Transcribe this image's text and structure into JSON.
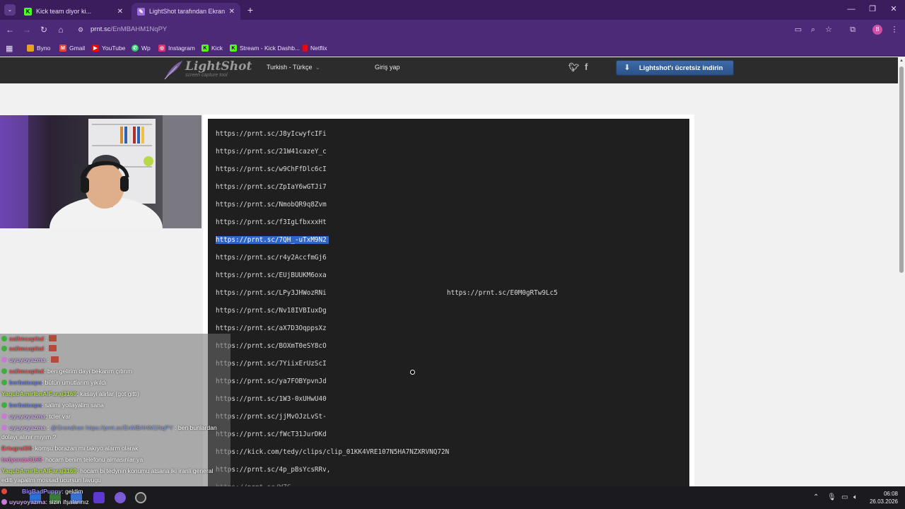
{
  "browser": {
    "tabs": [
      {
        "title": "Kick team diyor ki...",
        "favicon_color": "#53fc18"
      },
      {
        "title": "LightShot tarafından Ekran Gör",
        "favicon_color": "#9b6fd6"
      }
    ],
    "url_host": "prnt.sc",
    "url_path": "/EnMBAHM1NqPY",
    "bookmarks": [
      {
        "label": "Byno",
        "icon_color": "#e8a020"
      },
      {
        "label": "Gmail",
        "icon_color": "#ea4335"
      },
      {
        "label": "YouTube",
        "icon_color": "#ff0000"
      },
      {
        "label": "Wp",
        "icon_color": "#25d366"
      },
      {
        "label": "Instagram",
        "icon_color": "#e1306c"
      },
      {
        "label": "Kick",
        "icon_color": "#53fc18"
      },
      {
        "label": "Stream - Kick Dashb...",
        "icon_color": "#53fc18"
      },
      {
        "label": "Netflix",
        "icon_color": "#e50914"
      }
    ]
  },
  "lightshot": {
    "logo_name": "LightShot",
    "logo_tagline": "screen capture tool",
    "language": "Turkish - Türkçe",
    "login": "Giriş yap",
    "download_button": "Lightshot'ı ücretsiz indirin"
  },
  "screenshot_links": [
    "https://prnt.sc/J8yIcwyfcIFi",
    "https://prnt.sc/21W41cazeY_c",
    "https://prnt.sc/w9ChFfDlc6cI",
    "https://prnt.sc/ZpIaY6wGTJi7",
    "https://prnt.sc/NmobQR9q8Zvm",
    "https://prnt.sc/f3IgLfbxxxHt",
    "https://prnt.sc/7QH_-uTxM9N2",
    "https://prnt.sc/r4y2AccfmGj6",
    "https://prnt.sc/EUjBUUKM6oxa",
    "https://prnt.sc/LPy3JHWozRNi",
    "https://prnt.sc/Nv18IVBIuxDg",
    "https://prnt.sc/aX7D3OqppsXz",
    "https://prnt.sc/BOXmT0eSY8cO",
    "https://prnt.sc/7YiixErUzScI",
    "https://prnt.sc/ya7FOBYpvnJd",
    "https://prnt.sc/1W3-0xUHwU40",
    "https://prnt.sc/jjMvOJzLvSt-",
    "https://prnt.sc/fWcT31JurDKd",
    "https://kick.com/tedy/clips/clip_01KK4VRE107N5HA7NZXRVNQ72N",
    "https://prnt.sc/4p_pBsYcsRRv,"
  ],
  "screenshot_side_link": "https://prnt.sc/E0M0gRTw9Lc5",
  "chat": [
    {
      "user": "salimcapital",
      "text": "",
      "color": "red",
      "badge": "#3fae3f",
      "emote": true
    },
    {
      "user": "salimcapital",
      "text": "",
      "color": "red",
      "badge": "#3fae3f",
      "emote": true
    },
    {
      "user": "uyuyoyazma",
      "text": "",
      "color": "lav",
      "badge": "#c77ad6",
      "emote": true
    },
    {
      "user": "salimcapital",
      "text": ": ben gelirim dayı bekarım çıtırım",
      "color": "red",
      "badge": "#3fae3f"
    },
    {
      "user": "berbatcapa",
      "text": ": bütün umutlarım yıkıldı",
      "color": "blue",
      "badge": "#3fae3f"
    },
    {
      "user": "YaqubAmirIbnAlFaraj3169",
      "text": ": kasayi alirlar (got gitti)",
      "color": "yg",
      "badge": ""
    },
    {
      "user": "berbatcapa",
      "text": ": salimi yollayalim sana",
      "color": "blue",
      "badge": "#3fae3f"
    },
    {
      "user": "uyuyoyazma",
      "text": ": tcler var",
      "color": "lav",
      "badge": "#c77ad6"
    },
    {
      "user": "uyuyoyazma",
      "text": ": ben bunlardan",
      "color": "lav",
      "badge": "#c77ad6",
      "mention": "@Grendhan https://prnt.sc/EnMBAHM1NqPY"
    },
    {
      "user": "",
      "text": "dolayı alınır mıyım ?",
      "color": "",
      "badge": ""
    },
    {
      "user": "Ertugrul36",
      "text": ": komşu borazan mı takıyo alarm olarak",
      "color": "red",
      "badge": ""
    },
    {
      "user": "tedycrate3169",
      "text": ": hocam benim telefonu almasınlar ya",
      "color": "pink",
      "badge": ""
    },
    {
      "user": "YaqubAmirIbnAlFaraj3169",
      "text": ": hocam bi tedynin konumu atsana iki iranli general",
      "color": "yg",
      "badge": ""
    },
    {
      "user": "",
      "text": "editi yapalim mossad ucursun lavugu",
      "color": "",
      "badge": ""
    },
    {
      "user": "BigBadPuppy",
      "text": ": geldim",
      "color": "lav",
      "badge": "#e0483a"
    },
    {
      "user": "uyuyoyazma",
      "text": ": sizin ifşalarınız",
      "color": "lav",
      "badge": "#c77ad6"
    }
  ],
  "taskbar": {
    "time": "06:08",
    "date": "26.03.2026"
  }
}
